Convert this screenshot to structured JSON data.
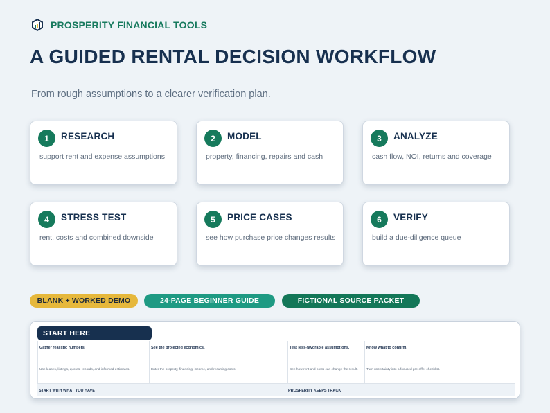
{
  "brand": {
    "name": "PROSPERITY FINANCIAL TOOLS",
    "logo_icon": "bar-chart-hexagon-icon"
  },
  "title": "A GUIDED RENTAL DECISION WORKFLOW",
  "subtitle": "From rough assumptions to a clearer verification plan.",
  "steps": [
    {
      "number": "1",
      "title": "RESEARCH",
      "desc": "support rent and expense assumptions"
    },
    {
      "number": "2",
      "title": "MODEL",
      "desc": "property, financing, repairs and cash"
    },
    {
      "number": "3",
      "title": "ANALYZE",
      "desc": "cash flow, NOI, returns and coverage"
    },
    {
      "number": "4",
      "title": "STRESS TEST",
      "desc": "rent, costs and combined downside"
    },
    {
      "number": "5",
      "title": "PRICE CASES",
      "desc": "see how purchase price changes results"
    },
    {
      "number": "6",
      "title": "VERIFY",
      "desc": "build a due-diligence queue"
    }
  ],
  "pills": {
    "demo": "BLANK + WORKED DEMO",
    "guide": "24-PAGE BEGINNER GUIDE",
    "packet": "FICTIONAL SOURCE PACKET"
  },
  "colors": {
    "brand_green": "#177a5e",
    "navy": "#17304f",
    "gold": "#e6b83c",
    "teal": "#1e9a83",
    "dark_green": "#137758",
    "background": "#eef3f7"
  },
  "sheet": {
    "tab_label": "START HERE",
    "columns": [
      {
        "heading": "Gather realistic numbers.",
        "body": "Use leases, listings, quotes, records, and informed estimates."
      },
      {
        "heading": "See the projected economics.",
        "body": "Enter the property, financing, income, and recurring costs."
      },
      {
        "heading": "Test less-favorable assumptions.",
        "body": "See how rent and costs can change the result."
      },
      {
        "heading": "Know what to confirm.",
        "body": "Turn uncertainty into a focused pre-offer checklist."
      }
    ],
    "footer_left": "START WITH WHAT YOU HAVE",
    "footer_right": "PROSPERITY KEEPS TRACK"
  }
}
